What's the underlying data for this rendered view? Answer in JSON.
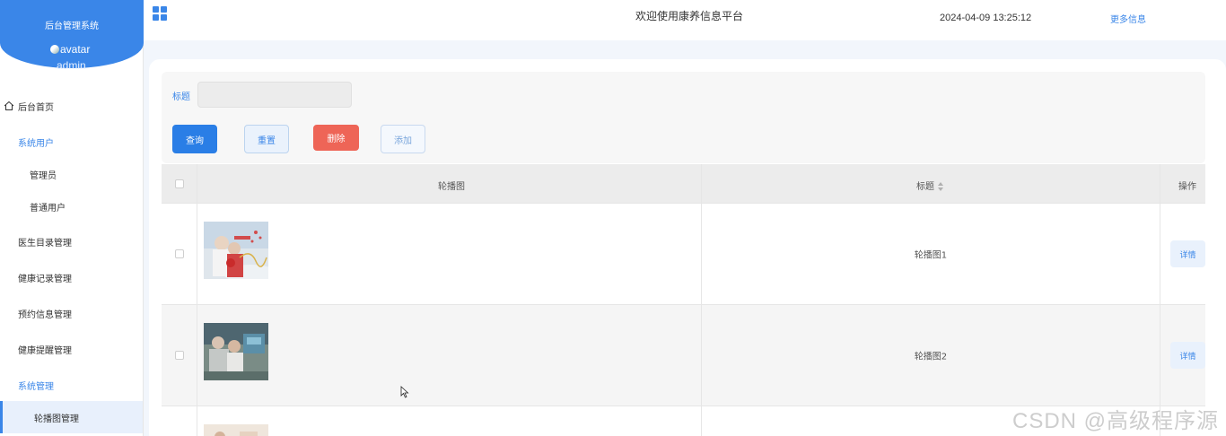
{
  "sidebar": {
    "brand_title": "后台管理系统",
    "avatar_alt": "avatar",
    "username": "admin",
    "items": [
      {
        "label": "后台首页",
        "icon": "home-icon"
      },
      {
        "label": "系统用户"
      },
      {
        "label": "管理员"
      },
      {
        "label": "普通用户"
      },
      {
        "label": "医生目录管理"
      },
      {
        "label": "健康记录管理"
      },
      {
        "label": "预约信息管理"
      },
      {
        "label": "健康提醒管理"
      },
      {
        "label": "系统管理"
      },
      {
        "label": "轮播图管理"
      }
    ],
    "accent": "#3a86e8"
  },
  "topbar": {
    "menu_icon": "grid-icon",
    "welcome": "欢迎使用康养信息平台",
    "datetime": "2024-04-09 13:25:12",
    "more_info": "更多信息"
  },
  "filter": {
    "title_label": "标题",
    "title_value": ""
  },
  "actions": {
    "query": "查询",
    "reset": "重置",
    "delete": "删除",
    "add": "添加"
  },
  "table": {
    "headers": {
      "image": "轮播图",
      "title": "标题",
      "ops": "操作"
    },
    "rows": [
      {
        "title": "轮播图1",
        "detail": "详情"
      },
      {
        "title": "轮播图2",
        "detail": "详情"
      }
    ]
  },
  "watermark": "CSDN @高级程序源"
}
